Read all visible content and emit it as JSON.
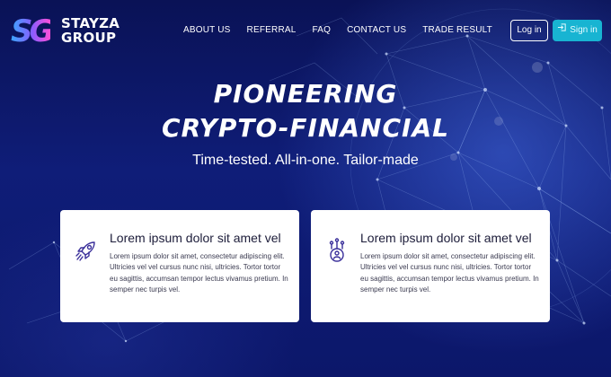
{
  "brand": {
    "mark": "SG",
    "name_line1": "STAYZA",
    "name_line2": "GROUP"
  },
  "nav": {
    "items": [
      "ABOUT US",
      "REFERRAL",
      "FAQ",
      "CONTACT US",
      "TRADE RESULT"
    ]
  },
  "auth": {
    "login_label": "Log in",
    "signin_label": "Sign in"
  },
  "hero": {
    "title_line1": "PIONEERING",
    "title_line2": "CRYPTO-FINANCIAL",
    "subtitle": "Time-tested. All-in-one. Tailor-made"
  },
  "cards": [
    {
      "icon": "rocket-icon",
      "title": "Lorem ipsum dolor sit amet vel",
      "body": "Lorem ipsum dolor sit amet, consectetur adipiscing elit. Ultricies vel vel cursus nunc nisi, ultricies. Tortor tortor eu sagittis, accumsan tempor lectus vivamus pretium. In semper nec turpis vel."
    },
    {
      "icon": "network-user-icon",
      "title": "Lorem ipsum dolor sit amet vel",
      "body": "Lorem ipsum dolor sit amet, consectetur adipiscing elit. Ultricies vel vel cursus nunc nisi, ultricies. Tortor tortor eu sagittis, accumsan tempor lectus vivamus pretium. In semper nec turpis vel."
    }
  ],
  "colors": {
    "background": "#0b1560",
    "accent": "#18b4d2",
    "card_icon": "#3a2f9a"
  }
}
